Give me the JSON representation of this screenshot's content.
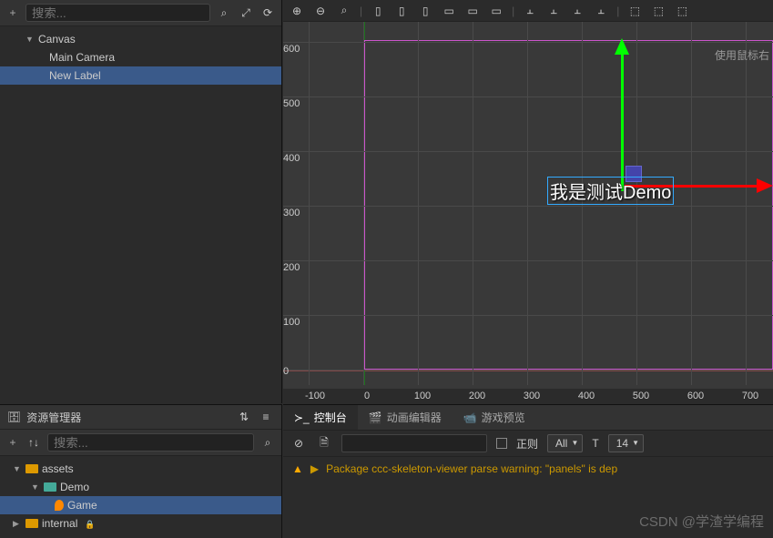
{
  "hierarchy": {
    "search_placeholder": "搜索...",
    "items": [
      {
        "label": "Canvas"
      },
      {
        "label": "Main Camera"
      },
      {
        "label": "New Label"
      }
    ]
  },
  "scene": {
    "hint": "使用鼠标右",
    "node_text": "我是测试Demo",
    "y_ticks": [
      "600",
      "500",
      "400",
      "300",
      "200",
      "100",
      "0"
    ],
    "x_ticks": [
      "-100",
      "0",
      "100",
      "200",
      "300",
      "400",
      "500",
      "600",
      "700"
    ]
  },
  "assets": {
    "title": "资源管理器",
    "search_placeholder": "搜索...",
    "tree": [
      {
        "label": "assets"
      },
      {
        "label": "Demo"
      },
      {
        "label": "Game"
      },
      {
        "label": "internal"
      }
    ]
  },
  "bottom": {
    "tabs": [
      {
        "label": "控制台"
      },
      {
        "label": "动画编辑器"
      },
      {
        "label": "游戏预览"
      }
    ],
    "regex_label": "正则",
    "filter": "All",
    "fontsize": "14",
    "warning": "Package ccc-skeleton-viewer parse warning: \"panels\" is dep"
  },
  "watermark": "CSDN @学渣学编程"
}
